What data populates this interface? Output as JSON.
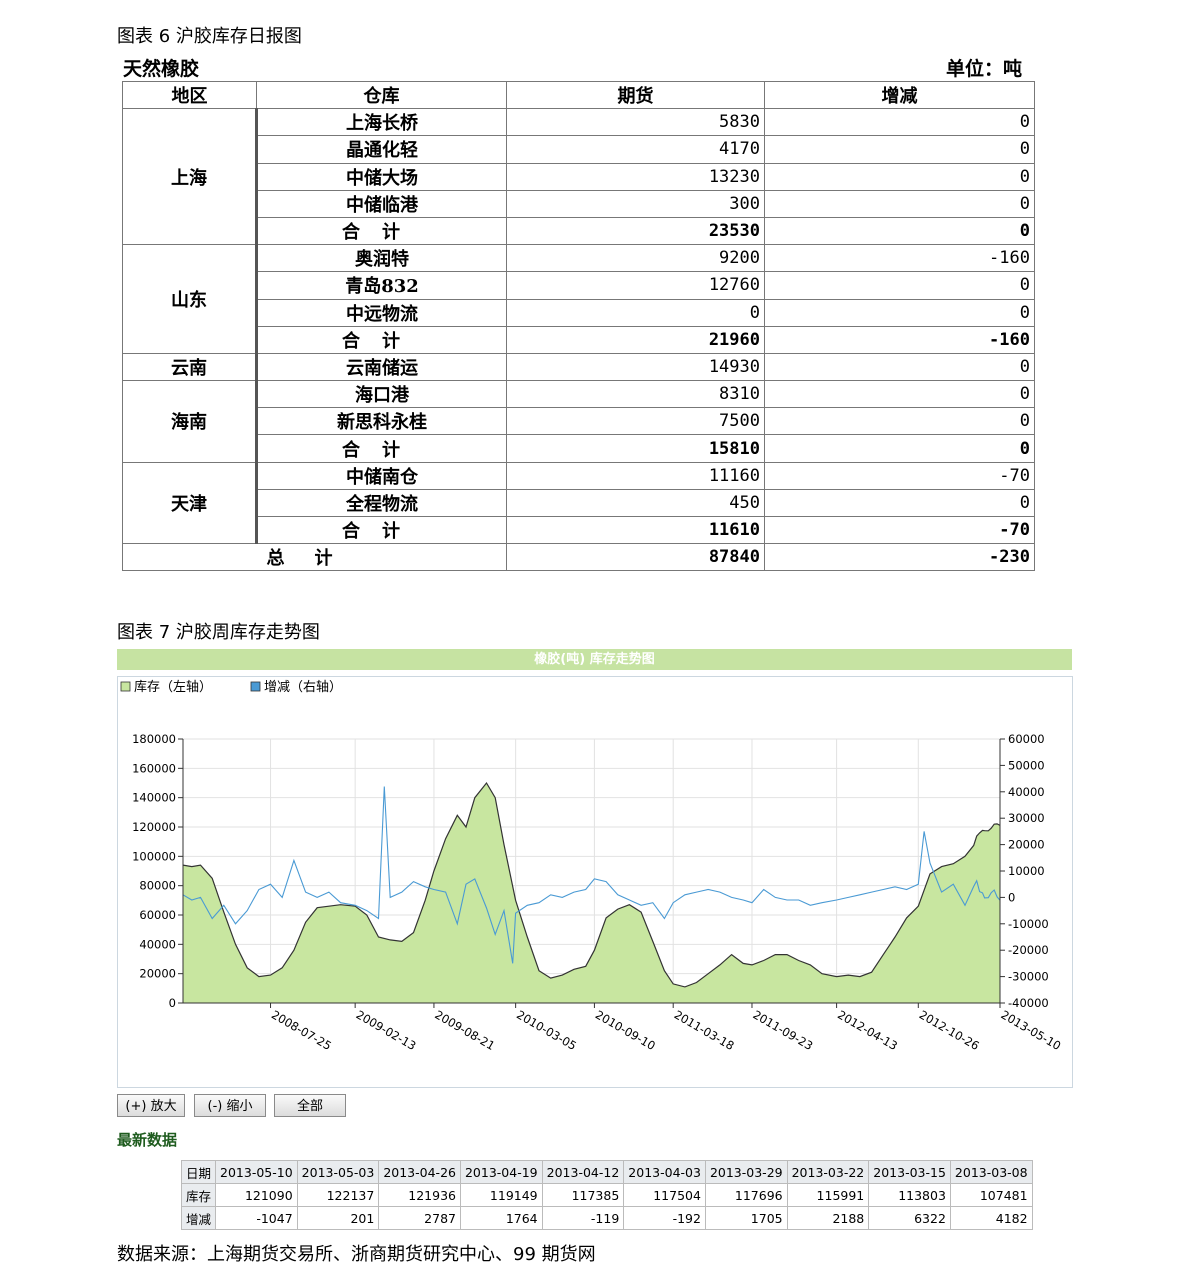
{
  "figure6": {
    "caption": "图表 6  沪胶库存日报图",
    "subtitle": "天然橡胶",
    "unit": "单位：吨",
    "headers": [
      "地区",
      "仓库",
      "期货",
      "增减"
    ],
    "rows": [
      {
        "region": "上海",
        "warehouse": "上海长桥",
        "futures": "5830",
        "change": "0"
      },
      {
        "region": "",
        "warehouse": "晶通化轻",
        "futures": "4170",
        "change": "0"
      },
      {
        "region": "",
        "warehouse": "中储大场",
        "futures": "13230",
        "change": "0"
      },
      {
        "region": "",
        "warehouse": "中储临港",
        "futures": "300",
        "change": "0"
      },
      {
        "region": "",
        "warehouse": "合计",
        "futures": "23530",
        "change": "0"
      },
      {
        "region": "山东",
        "warehouse": "奥润特",
        "futures": "9200",
        "change": "-160"
      },
      {
        "region": "",
        "warehouse": "青岛832",
        "futures": "12760",
        "change": "0"
      },
      {
        "region": "",
        "warehouse": "中远物流",
        "futures": "0",
        "change": "0"
      },
      {
        "region": "",
        "warehouse": "合计",
        "futures": "21960",
        "change": "-160"
      },
      {
        "region": "云南",
        "warehouse": "云南储运",
        "futures": "14930",
        "change": "0"
      },
      {
        "region": "海南",
        "warehouse": "海口港",
        "futures": "8310",
        "change": "0"
      },
      {
        "region": "",
        "warehouse": "新思科永桂",
        "futures": "7500",
        "change": "0"
      },
      {
        "region": "",
        "warehouse": "合计",
        "futures": "15810",
        "change": "0"
      },
      {
        "region": "天津",
        "warehouse": "中储南仓",
        "futures": "11160",
        "change": "-70"
      },
      {
        "region": "",
        "warehouse": "全程物流",
        "futures": "450",
        "change": "0"
      },
      {
        "region": "",
        "warehouse": "合计",
        "futures": "11610",
        "change": "-70"
      }
    ],
    "total": {
      "label": "总计",
      "futures": "87840",
      "change": "-230"
    }
  },
  "figure7": {
    "caption": "图表 7  沪胶周库存走势图",
    "buttons": {
      "zoom_in": "(+) 放大",
      "zoom_out": "(-) 缩小",
      "all": "全部"
    },
    "latest_title": "最新数据",
    "latest": {
      "row_labels": [
        "日期",
        "库存",
        "增减"
      ],
      "dates": [
        "2013-05-10",
        "2013-05-03",
        "2013-04-26",
        "2013-04-19",
        "2013-04-12",
        "2013-04-03",
        "2013-03-29",
        "2013-03-22",
        "2013-03-15",
        "2013-03-08"
      ],
      "inventory": [
        "121090",
        "122137",
        "121936",
        "119149",
        "117385",
        "117504",
        "117696",
        "115991",
        "113803",
        "107481"
      ],
      "change": [
        "-1047",
        "201",
        "2787",
        "1764",
        "-119",
        "-192",
        "1705",
        "2188",
        "6322",
        "4182"
      ]
    }
  },
  "source": "数据来源：上海期货交易所、浙商期货研究中心、99 期货网",
  "colors": {
    "area_fill": "#c8e6a0",
    "area_line": "#333333",
    "change_line": "#4a9ad4",
    "title_bar": "#c6e3a2"
  },
  "chart_data": {
    "type": "area",
    "title": "橡胶(吨) 库存走势图",
    "legend": [
      "库存（左轴）",
      "增减（右轴）"
    ],
    "legend_position": "top-left",
    "grid": true,
    "x_ticks": [
      "2008-07-25",
      "2009-02-13",
      "2009-08-21",
      "2010-03-05",
      "2010-09-10",
      "2011-03-18",
      "2011-09-23",
      "2012-04-13",
      "2012-10-26",
      "2013-05-10"
    ],
    "left_ticks": [
      "180000",
      "160000",
      "140000",
      "120000",
      "100000",
      "80000",
      "60000",
      "40000",
      "20000",
      "0"
    ],
    "right_ticks": [
      "60000",
      "50000",
      "40000",
      "30000",
      "20000",
      "10000",
      "0",
      "-10000",
      "-20000",
      "-30000",
      "-40000"
    ],
    "ylim_left": [
      0,
      180000
    ],
    "ylim_right": [
      -40000,
      60000
    ],
    "xlim": [
      "2007-12-28",
      "2013-05-10"
    ],
    "series": [
      {
        "name": "库存（左轴）",
        "axis": "left",
        "type": "area",
        "points": [
          [
            "2007-12-28",
            94000
          ],
          [
            "2008-01-18",
            93000
          ],
          [
            "2008-02-08",
            94000
          ],
          [
            "2008-03-07",
            85000
          ],
          [
            "2008-04-04",
            62000
          ],
          [
            "2008-05-02",
            40000
          ],
          [
            "2008-05-30",
            24000
          ],
          [
            "2008-06-27",
            18000
          ],
          [
            "2008-07-25",
            19000
          ],
          [
            "2008-08-22",
            24000
          ],
          [
            "2008-09-19",
            36000
          ],
          [
            "2008-10-17",
            55000
          ],
          [
            "2008-11-14",
            65000
          ],
          [
            "2008-12-12",
            66000
          ],
          [
            "2009-01-09",
            67000
          ],
          [
            "2009-02-13",
            66000
          ],
          [
            "2009-03-13",
            60000
          ],
          [
            "2009-04-10",
            45000
          ],
          [
            "2009-05-08",
            43000
          ],
          [
            "2009-06-05",
            42000
          ],
          [
            "2009-07-03",
            48000
          ],
          [
            "2009-07-31",
            70000
          ],
          [
            "2009-08-21",
            90000
          ],
          [
            "2009-09-18",
            112000
          ],
          [
            "2009-10-16",
            128000
          ],
          [
            "2009-11-06",
            120000
          ],
          [
            "2009-11-27",
            140000
          ],
          [
            "2009-12-25",
            150000
          ],
          [
            "2010-01-15",
            140000
          ],
          [
            "2010-02-05",
            108000
          ],
          [
            "2010-03-05",
            70000
          ],
          [
            "2010-04-02",
            45000
          ],
          [
            "2010-04-30",
            22000
          ],
          [
            "2010-05-28",
            17000
          ],
          [
            "2010-06-25",
            19000
          ],
          [
            "2010-07-23",
            23000
          ],
          [
            "2010-08-20",
            25000
          ],
          [
            "2010-09-10",
            36000
          ],
          [
            "2010-10-08",
            58000
          ],
          [
            "2010-11-05",
            64000
          ],
          [
            "2010-12-03",
            67000
          ],
          [
            "2010-12-31",
            62000
          ],
          [
            "2011-01-28",
            42000
          ],
          [
            "2011-02-25",
            22000
          ],
          [
            "2011-03-18",
            13000
          ],
          [
            "2011-04-15",
            11000
          ],
          [
            "2011-05-13",
            14000
          ],
          [
            "2011-06-10",
            20000
          ],
          [
            "2011-07-08",
            26000
          ],
          [
            "2011-08-05",
            33000
          ],
          [
            "2011-09-02",
            27000
          ],
          [
            "2011-09-23",
            26000
          ],
          [
            "2011-10-21",
            29000
          ],
          [
            "2011-11-18",
            33000
          ],
          [
            "2011-12-16",
            33000
          ],
          [
            "2012-01-13",
            29000
          ],
          [
            "2012-02-10",
            26000
          ],
          [
            "2012-03-09",
            20000
          ],
          [
            "2012-04-13",
            18000
          ],
          [
            "2012-05-11",
            19000
          ],
          [
            "2012-06-08",
            18000
          ],
          [
            "2012-07-06",
            21000
          ],
          [
            "2012-08-03",
            33000
          ],
          [
            "2012-08-31",
            45000
          ],
          [
            "2012-09-28",
            58000
          ],
          [
            "2012-10-26",
            66000
          ],
          [
            "2012-11-23",
            88000
          ],
          [
            "2012-12-21",
            93000
          ],
          [
            "2013-01-18",
            95000
          ],
          [
            "2013-02-15",
            100000
          ],
          [
            "2013-03-08",
            107481
          ],
          [
            "2013-03-15",
            113803
          ],
          [
            "2013-03-22",
            115991
          ],
          [
            "2013-03-29",
            117696
          ],
          [
            "2013-04-03",
            117504
          ],
          [
            "2013-04-12",
            117385
          ],
          [
            "2013-04-19",
            119149
          ],
          [
            "2013-04-26",
            121936
          ],
          [
            "2013-05-03",
            122137
          ],
          [
            "2013-05-10",
            121090
          ]
        ]
      },
      {
        "name": "增减（右轴）",
        "axis": "right",
        "type": "line",
        "points": [
          [
            "2007-12-28",
            1000
          ],
          [
            "2008-01-18",
            -1000
          ],
          [
            "2008-02-08",
            0
          ],
          [
            "2008-03-07",
            -8000
          ],
          [
            "2008-04-04",
            -3000
          ],
          [
            "2008-05-02",
            -10000
          ],
          [
            "2008-05-30",
            -5000
          ],
          [
            "2008-06-27",
            3000
          ],
          [
            "2008-07-25",
            5000
          ],
          [
            "2008-08-22",
            0
          ],
          [
            "2008-09-19",
            14000
          ],
          [
            "2008-10-17",
            2000
          ],
          [
            "2008-11-14",
            0
          ],
          [
            "2008-12-12",
            2000
          ],
          [
            "2009-01-09",
            -2000
          ],
          [
            "2009-02-13",
            -3000
          ],
          [
            "2009-03-13",
            -5000
          ],
          [
            "2009-04-10",
            -8000
          ],
          [
            "2009-04-24",
            42000
          ],
          [
            "2009-05-08",
            0
          ],
          [
            "2009-06-05",
            2000
          ],
          [
            "2009-07-03",
            6000
          ],
          [
            "2009-07-31",
            4000
          ],
          [
            "2009-08-21",
            3000
          ],
          [
            "2009-09-18",
            2000
          ],
          [
            "2009-10-16",
            -10000
          ],
          [
            "2009-11-06",
            5000
          ],
          [
            "2009-11-27",
            7000
          ],
          [
            "2009-12-25",
            -4000
          ],
          [
            "2010-01-15",
            -14000
          ],
          [
            "2010-02-05",
            -5000
          ],
          [
            "2010-02-26",
            -25000
          ],
          [
            "2010-03-05",
            -6000
          ],
          [
            "2010-04-02",
            -3000
          ],
          [
            "2010-04-30",
            -2000
          ],
          [
            "2010-05-28",
            1000
          ],
          [
            "2010-06-25",
            0
          ],
          [
            "2010-07-23",
            2000
          ],
          [
            "2010-08-20",
            3000
          ],
          [
            "2010-09-10",
            7000
          ],
          [
            "2010-10-08",
            6000
          ],
          [
            "2010-11-05",
            1000
          ],
          [
            "2010-12-03",
            -1000
          ],
          [
            "2010-12-31",
            -3000
          ],
          [
            "2011-01-28",
            -2000
          ],
          [
            "2011-02-25",
            -8000
          ],
          [
            "2011-03-18",
            -2000
          ],
          [
            "2011-04-15",
            1000
          ],
          [
            "2011-05-13",
            2000
          ],
          [
            "2011-06-10",
            3000
          ],
          [
            "2011-07-08",
            2000
          ],
          [
            "2011-08-05",
            0
          ],
          [
            "2011-09-02",
            -1000
          ],
          [
            "2011-09-23",
            -2000
          ],
          [
            "2011-10-21",
            3000
          ],
          [
            "2011-11-18",
            0
          ],
          [
            "2011-12-16",
            -1000
          ],
          [
            "2012-01-13",
            -1000
          ],
          [
            "2012-02-10",
            -3000
          ],
          [
            "2012-03-09",
            -2000
          ],
          [
            "2012-04-13",
            -1000
          ],
          [
            "2012-05-11",
            0
          ],
          [
            "2012-06-08",
            1000
          ],
          [
            "2012-07-06",
            2000
          ],
          [
            "2012-08-03",
            3000
          ],
          [
            "2012-08-31",
            4000
          ],
          [
            "2012-09-28",
            3000
          ],
          [
            "2012-10-26",
            5000
          ],
          [
            "2012-11-09",
            25000
          ],
          [
            "2012-11-23",
            13000
          ],
          [
            "2012-12-21",
            2000
          ],
          [
            "2013-01-18",
            5000
          ],
          [
            "2013-02-15",
            -3000
          ],
          [
            "2013-03-08",
            4182
          ],
          [
            "2013-03-15",
            6322
          ],
          [
            "2013-03-22",
            2188
          ],
          [
            "2013-03-29",
            1705
          ],
          [
            "2013-04-03",
            -192
          ],
          [
            "2013-04-12",
            -119
          ],
          [
            "2013-04-19",
            1764
          ],
          [
            "2013-04-26",
            2787
          ],
          [
            "2013-05-03",
            201
          ],
          [
            "2013-05-10",
            -1047
          ]
        ]
      }
    ]
  }
}
